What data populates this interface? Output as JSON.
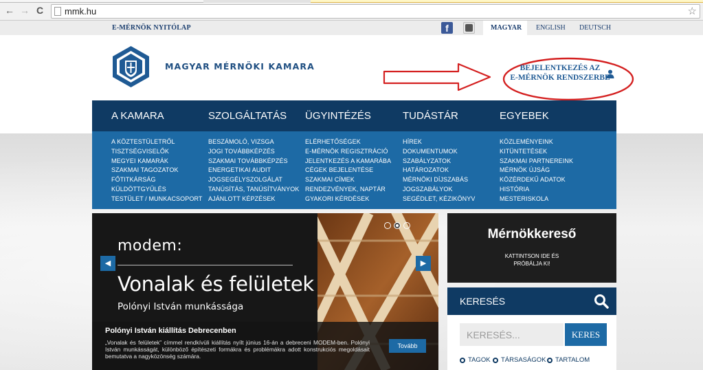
{
  "browser": {
    "url": "mmk.hu",
    "back_glyph": "←",
    "forward_glyph": "→",
    "reload_glyph": "C",
    "star_glyph": "☆"
  },
  "topbar": {
    "home_link": "E-MÉRNÖK NYITÓLAP",
    "facebook_glyph": "f",
    "languages": [
      "MAGYAR",
      "ENGLISH",
      "DEUTSCH"
    ]
  },
  "header": {
    "site_name": "MAGYAR MÉRNÖKI KAMARA",
    "login_line1": "BEJELENTKEZÉS AZ",
    "login_line2": "E-MÉRNÖK RENDSZERBE"
  },
  "menu": {
    "columns": [
      {
        "title": "A KAMARA",
        "items": [
          "A KÖZTESTÜLETRŐL",
          "TISZTSÉGVISELŐK",
          "MEGYEI KAMARÁK",
          "SZAKMAI TAGOZATOK",
          "FŐTITKÁRSÁG",
          "KÜLDÖTTGYŰLÉS",
          "TESTÜLET / MUNKACSOPORT"
        ]
      },
      {
        "title": "SZOLGÁLTATÁS",
        "items": [
          "BESZÁMOLÓ, VIZSGA",
          "JOGI TOVÁBBKÉPZÉS",
          "SZAKMAI TOVÁBBKÉPZÉS",
          "ENERGETIKAI AUDIT",
          "JOGSEGÉLYSZOLGÁLAT",
          "TANÚSÍTÁS, TANÚSÍTVÁNYOK",
          "AJÁNLOTT KÉPZÉSEK"
        ]
      },
      {
        "title": "ÜGYINTÉZÉS",
        "items": [
          "ELÉRHETŐSÉGEK",
          "E-MÉRNÖK REGISZTRÁCIÓ",
          "JELENTKEZÉS A KAMARÁBA",
          "CÉGEK BEJELENTÉSE",
          "SZAKMAI CÍMEK",
          "RENDEZVÉNYEK, NAPTÁR",
          "GYAKORI KÉRDÉSEK"
        ]
      },
      {
        "title": "TUDÁSTÁR",
        "items": [
          "HÍREK",
          "DOKUMENTUMOK",
          "SZABÁLYZATOK",
          "HATÁROZATOK",
          "MÉRNÖKI DÍJSZABÁS",
          "JOGSZABÁLYOK",
          "SEGÉDLET, KÉZIKÖNYV"
        ]
      },
      {
        "title": "EGYEBEK",
        "items": [
          "KÖZLEMÉNYEINK",
          "KITÜNTETÉSEK",
          "SZAKMAI PARTNEREINK",
          "MÉRNÖK ÚJSÁG",
          "KÖZÉRDEKŰ ADATOK",
          "HISTÓRIA",
          "MESTERISKOLA"
        ]
      }
    ]
  },
  "slider": {
    "logo_text": "modem:",
    "title": "Vonalak és felületek",
    "subtitle": "Polónyi István munkássága",
    "caption_title": "Polónyi István kiállítás Debrecenben",
    "caption_text": "„Vonalak és felületek” címmel rendkívüli kiállítás nyílt június 16-án a debreceni MODEM-ben. Polónyi István munkásságát, különböző építészeti formákra és problémákra adott konstrukciós megoldásait bemutatva a nagyközönség számára.",
    "more_label": "Tovább",
    "prev_glyph": "◀",
    "next_glyph": "▶",
    "dots": 3,
    "active_dot": 2
  },
  "finder": {
    "title": "Mérnökkereső",
    "subtitle": "KATTINTSON IDE ÉS PRÓBÁLJA KI!"
  },
  "search": {
    "title": "KERESÉS",
    "placeholder": "KERESÉS...",
    "button": "KERES",
    "options": [
      "TAGOK",
      "TÁRSASÁGOK",
      "TARTALOM"
    ]
  },
  "colors": {
    "navy": "#0f3a63",
    "blue": "#1d6aa5",
    "annotation_red": "#d42020"
  }
}
